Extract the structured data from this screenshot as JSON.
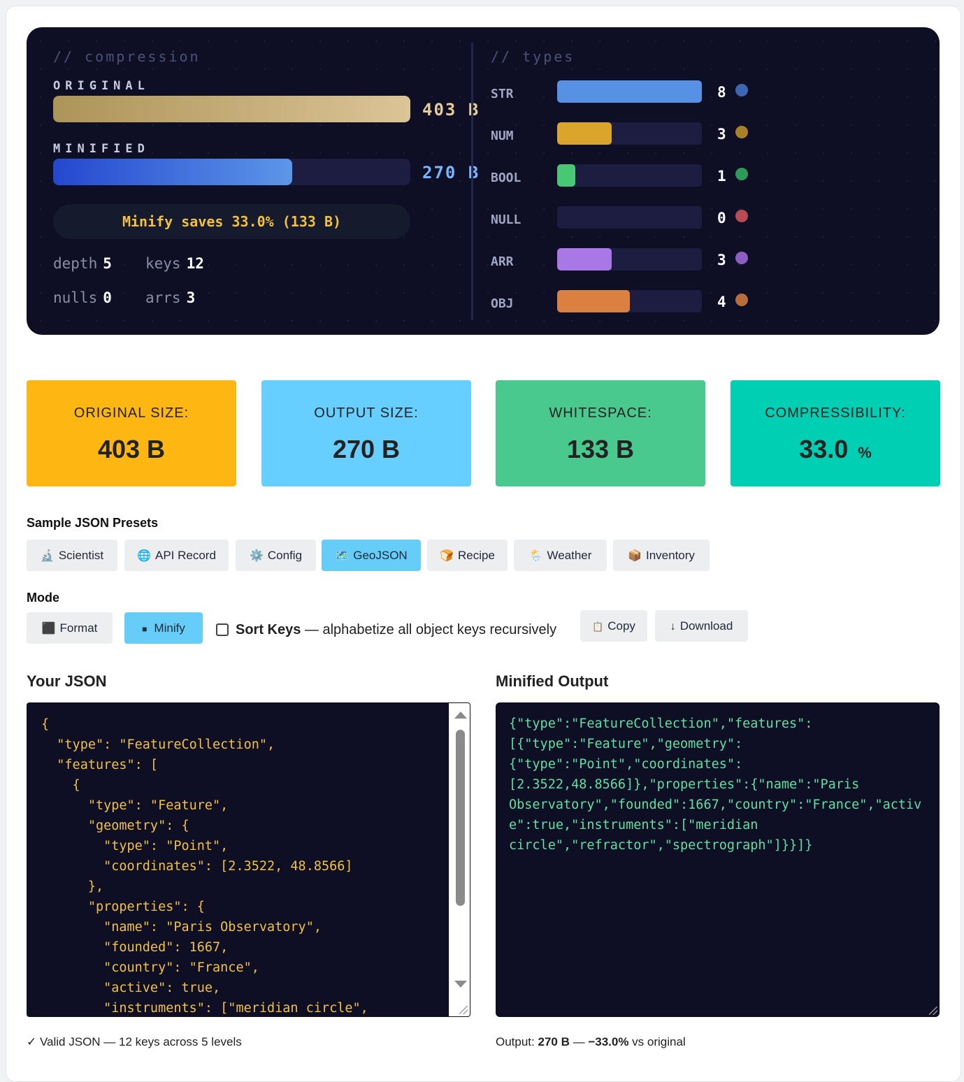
{
  "viz": {
    "compression_comment": "// compression",
    "types_comment": "// types",
    "original_label": "ORIGINAL",
    "minified_label": "MINIFIED",
    "original_value": "403 B",
    "minified_value": "270 B",
    "original_fraction": 1.0,
    "minified_fraction": 0.67,
    "savings_text": "Minify saves 33.0% (133 B)",
    "stats": {
      "depth_label": "depth",
      "depth_value": "5",
      "keys_label": "keys",
      "keys_value": "12",
      "nulls_label": "nulls",
      "nulls_value": "0",
      "arrs_label": "arrs",
      "arrs_value": "3"
    },
    "types": [
      {
        "label": "STR",
        "count": "8",
        "value": 8,
        "color": "#5791e3",
        "dot": "#3d67b5"
      },
      {
        "label": "NUM",
        "count": "3",
        "value": 3,
        "color": "#dba52b",
        "dot": "#a8802a"
      },
      {
        "label": "BOOL",
        "count": "1",
        "value": 1,
        "color": "#48c774",
        "dot": "#2e9a5a"
      },
      {
        "label": "NULL",
        "count": "0",
        "value": 0,
        "color": "#d05a5a",
        "dot": "#b84c55"
      },
      {
        "label": "ARR",
        "count": "3",
        "value": 3,
        "color": "#a878e6",
        "dot": "#8c5dc4"
      },
      {
        "label": "OBJ",
        "count": "4",
        "value": 4,
        "color": "#db8040",
        "dot": "#b86d3a"
      }
    ],
    "types_max": 8
  },
  "cards": [
    {
      "label": "ORIGINAL SIZE:",
      "value": "403 B",
      "unit": "",
      "color": "#fdb612"
    },
    {
      "label": "OUTPUT SIZE:",
      "value": "270 B",
      "unit": "",
      "color": "#66cfff"
    },
    {
      "label": "WHITESPACE:",
      "value": "133 B",
      "unit": "",
      "color": "#4ac98f"
    },
    {
      "label": "COMPRESSIBILITY:",
      "value": "33.0",
      "unit": "%",
      "color": "#00cfb4"
    }
  ],
  "presets": {
    "title": "Sample JSON Presets",
    "items": [
      {
        "icon": "🔬",
        "icon_name": "microscope-icon",
        "label": "Scientist",
        "active": false
      },
      {
        "icon": "🌐",
        "icon_name": "globe-icon",
        "label": "API Record",
        "active": false
      },
      {
        "icon": "⚙️",
        "icon_name": "gear-icon",
        "label": "Config",
        "active": false
      },
      {
        "icon": "🗺️",
        "icon_name": "map-icon",
        "label": "GeoJSON",
        "active": true
      },
      {
        "icon": "🍞",
        "icon_name": "bread-icon",
        "label": "Recipe",
        "active": false
      },
      {
        "icon": "🌦️",
        "icon_name": "weather-icon",
        "label": "Weather",
        "active": false
      },
      {
        "icon": "📦",
        "icon_name": "box-icon",
        "label": "Inventory",
        "active": false
      }
    ]
  },
  "mode": {
    "title": "Mode",
    "format_icon": "⬛",
    "format_label": "Format",
    "minify_icon": "■",
    "minify_label": "Minify",
    "active": "Minify",
    "sort_keys_label": "Sort Keys",
    "sort_keys_desc": " — alphabetize all object keys recursively",
    "sort_keys_checked": false,
    "copy_icon": "📋",
    "copy_label": "Copy",
    "download_icon": "↓",
    "download_label": "Download"
  },
  "input": {
    "title": "Your JSON",
    "lines": [
      "{",
      "  \"type\": \"FeatureCollection\",",
      "  \"features\": [",
      "    {",
      "      \"type\": \"Feature\",",
      "      \"geometry\": {",
      "        \"type\": \"Point\",",
      "        \"coordinates\": [2.3522, 48.8566]",
      "      },",
      "      \"properties\": {",
      "        \"name\": \"Paris Observatory\",",
      "        \"founded\": 1667,",
      "        \"country\": \"France\",",
      "        \"active\": true,",
      "        \"instruments\": [\"meridian circle\","
    ],
    "status": "✓ Valid JSON — 12 keys across 5 levels"
  },
  "output": {
    "title": "Minified Output",
    "lines": [
      "{\"type\":\"FeatureCollection\",\"features\":",
      "[{\"type\":\"Feature\",\"geometry\":",
      "{\"type\":\"Point\",\"coordinates\":",
      "[2.3522,48.8566]},\"properties\":{\"name\":\"Paris",
      "Observatory\",\"founded\":1667,\"country\":\"France\",\"activ",
      "e\":true,\"instruments\":[\"meridian",
      "circle\",\"refractor\",\"spectrograph\"]}}]}"
    ],
    "status_prefix": "Output: ",
    "status_size": "270 B",
    "status_mid": " — ",
    "status_pct": "−33.0%",
    "status_suffix": " vs original"
  }
}
